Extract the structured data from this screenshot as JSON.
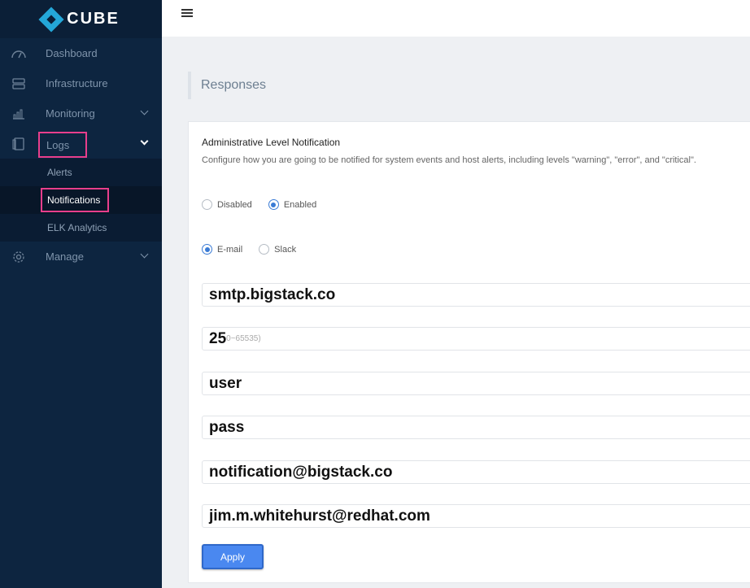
{
  "app": {
    "logo_text": "CUBE"
  },
  "sidebar": {
    "items": [
      {
        "label": "Dashboard",
        "icon": "dashboard-icon"
      },
      {
        "label": "Infrastructure",
        "icon": "server-icon"
      },
      {
        "label": "Monitoring",
        "icon": "bar-chart-icon"
      },
      {
        "label": "Logs",
        "icon": "logs-icon"
      },
      {
        "label": "Manage",
        "icon": "gear-icon"
      }
    ],
    "logs_subitems": [
      {
        "label": "Alerts"
      },
      {
        "label": "Notifications"
      },
      {
        "label": "ELK Analytics"
      }
    ]
  },
  "page": {
    "title": "Responses"
  },
  "card": {
    "title": "Administrative Level Notification",
    "description": "Configure how you are going to be notified for system events and host alerts, including levels \"warning\", \"error\", and \"critical\".",
    "state_options": [
      "Disabled",
      "Enabled"
    ],
    "state_selected": "Enabled",
    "channel_options": [
      "E-mail",
      "Slack"
    ],
    "channel_selected": "E-mail",
    "fields": {
      "smtp_host": "smtp.bigstack.co",
      "smtp_port": "25",
      "smtp_port_hint": "0~65535)",
      "username": "user",
      "password": "pass",
      "sender": "notification@bigstack.co",
      "recipient": "jim.m.whitehurst@redhat.com"
    },
    "apply_label": "Apply"
  },
  "colors": {
    "sidebar_bg": "#0d2540",
    "highlight": "#e83e8c",
    "accent": "#3a7bd5",
    "button": "#4a88f0"
  }
}
